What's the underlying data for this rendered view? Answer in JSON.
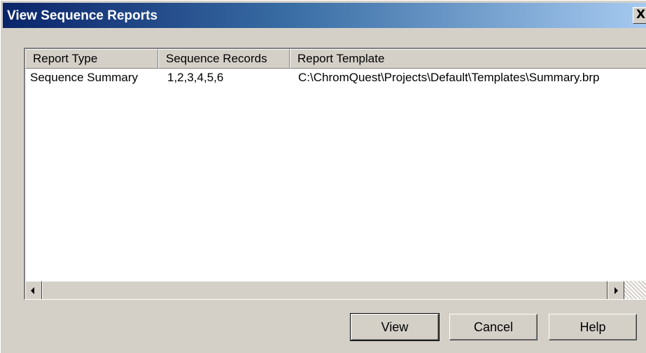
{
  "window": {
    "title": "View Sequence Reports",
    "close_glyph": "✕"
  },
  "list": {
    "columns": [
      "Report Type",
      "Sequence Records",
      "Report Template"
    ],
    "rows": [
      [
        "Sequence Summary",
        "1,2,3,4,5,6",
        "C:\\ChromQuest\\Projects\\Default\\Templates\\Summary.brp"
      ]
    ]
  },
  "buttons": {
    "view_label": "View",
    "cancel_label": "Cancel",
    "help_label": "Help"
  },
  "icons": {
    "close": "close-icon",
    "scroll_left": "arrow-left-icon",
    "scroll_right": "arrow-right-icon"
  },
  "colors": {
    "title_gradient_start": "#0a246a",
    "title_gradient_end": "#a6caf0",
    "dialog_face": "#d4d0c8"
  }
}
